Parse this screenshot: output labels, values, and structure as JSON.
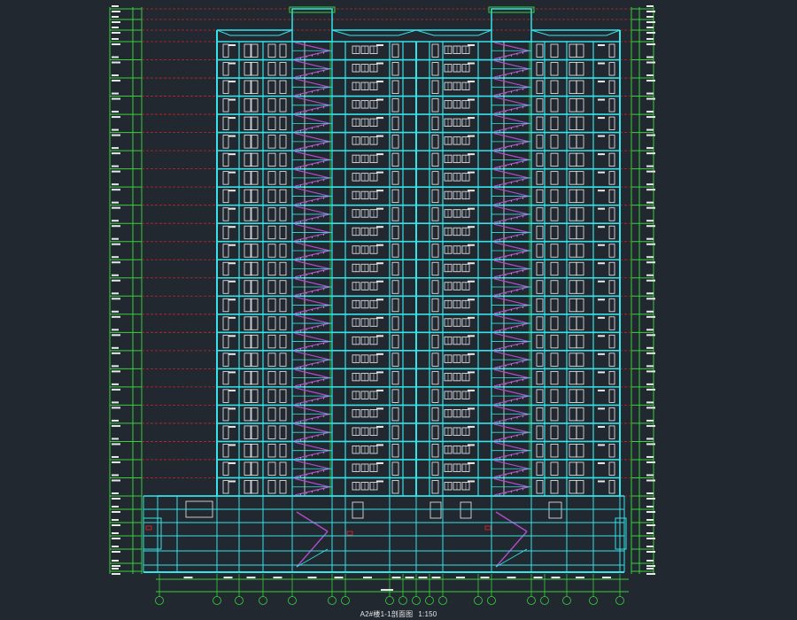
{
  "drawing": {
    "title": "A2#楼1-1剖面图",
    "scale": "1:150",
    "colors": {
      "background": "#212830",
      "structure": "#35e3e8",
      "dimension": "#39d13c",
      "floor_line": "#c8242b",
      "window": "#f2f2f2",
      "stair": "#b04dc8",
      "text": "#e8e8e8"
    }
  }
}
